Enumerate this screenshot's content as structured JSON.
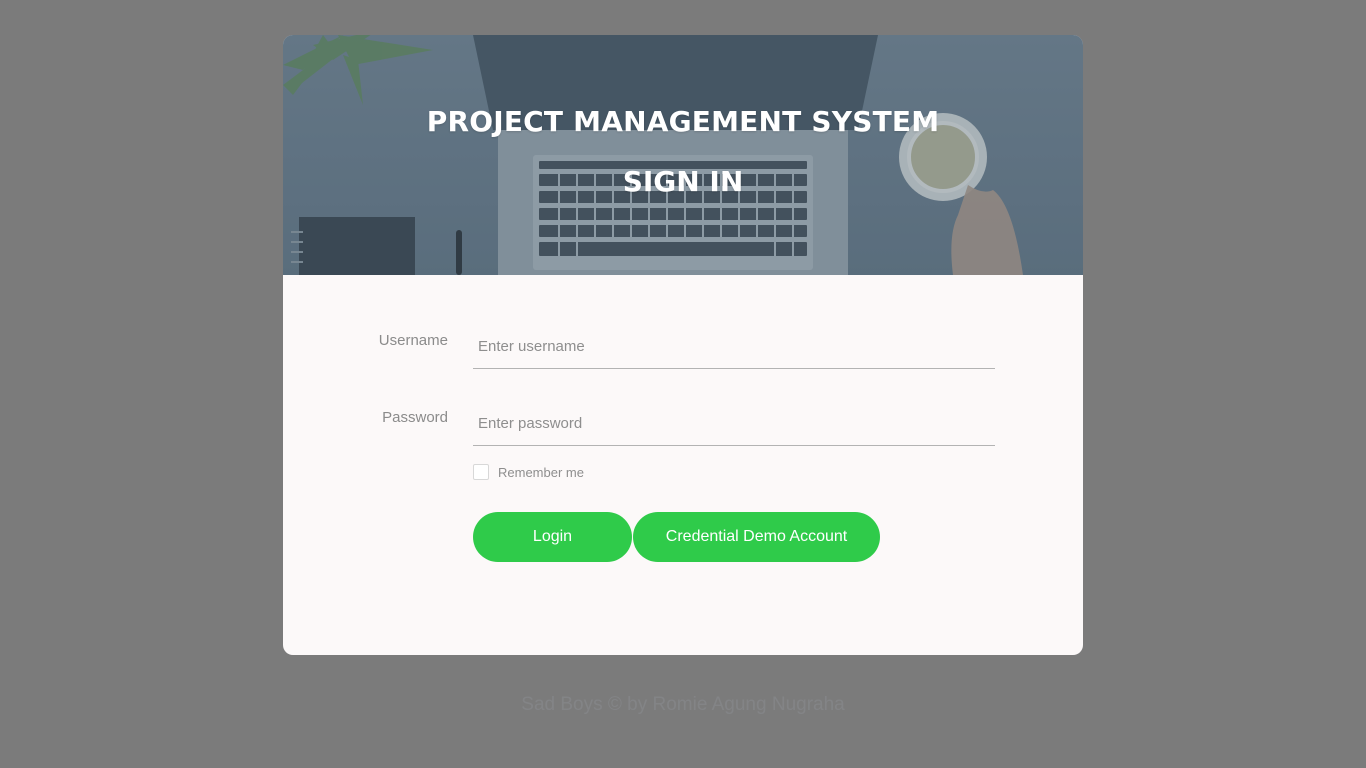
{
  "hero": {
    "title": "PROJECT MANAGEMENT SYSTEM",
    "subtitle": "SIGN IN"
  },
  "form": {
    "username": {
      "label": "Username",
      "placeholder": "Enter username",
      "value": ""
    },
    "password": {
      "label": "Password",
      "placeholder": "Enter password",
      "value": ""
    },
    "remember": {
      "label": "Remember me",
      "checked": false
    },
    "login_label": "Login",
    "demo_label": "Credential Demo Account"
  },
  "footer": {
    "text": "Sad Boys © by Romie Agung Nugraha"
  },
  "colors": {
    "accent": "#2fcb4a",
    "background": "#7b7b7b",
    "card": "#fcf9f9"
  }
}
